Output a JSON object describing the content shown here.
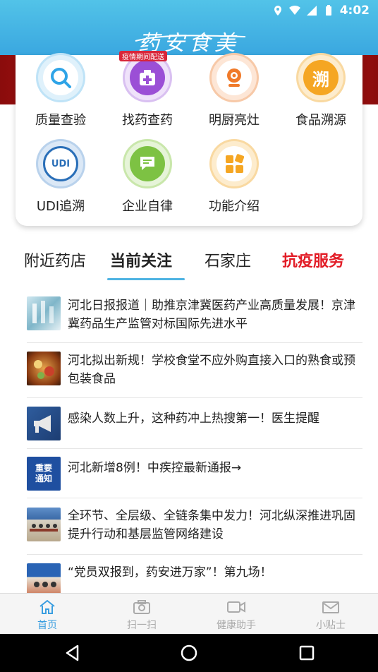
{
  "status_bar": {
    "time": "4:02"
  },
  "header": {
    "logo_text": "药安食美"
  },
  "functions": [
    {
      "label": "质量查验",
      "icon": "search-icon",
      "color": "#2fa4e7"
    },
    {
      "label": "找药查药",
      "icon": "medicine-box-icon",
      "color": "#9b4fd6",
      "badge": "疫情期间配送"
    },
    {
      "label": "明厨亮灶",
      "icon": "camera-icon",
      "color": "#f07a2a"
    },
    {
      "label": "食品溯源",
      "icon": "trace-icon",
      "color": "#f5a623",
      "glyph": "溯"
    },
    {
      "label": "UDI追溯",
      "icon": "udi-icon",
      "color": "#2a6fb8",
      "glyph": "UDI"
    },
    {
      "label": "企业自律",
      "icon": "chat-icon",
      "color": "#7dc243"
    },
    {
      "label": "功能介绍",
      "icon": "grid-icon",
      "color": "#f5a623"
    }
  ],
  "tabs": [
    {
      "label": "附近药店"
    },
    {
      "label": "当前关注"
    },
    {
      "label": "石家庄"
    },
    {
      "label": "抗疫服务"
    }
  ],
  "news": [
    {
      "title": "河北日报报道｜助推京津冀医药产业高质量发展！京津冀药品生产监管对标国际先进水平",
      "thumb": "lab"
    },
    {
      "title": "河北拟出新规！学校食堂不应外购直接入口的熟食或预包装食品",
      "thumb": "food"
    },
    {
      "title": "感染人数上升，这种药冲上热搜第一！医生提醒",
      "thumb": "megaphone"
    },
    {
      "title": "河北新增8例！中疾控最新通报→",
      "thumb": "notice",
      "thumb_text_1": "重要",
      "thumb_text_2": "通知"
    },
    {
      "title": "全环节、全层级、全链条集中发力！河北纵深推进巩固提升行动和基层监管网络建设",
      "thumb": "meeting"
    },
    {
      "title": "“党员双报到，药安进万家”！第九场！",
      "thumb": "event"
    }
  ],
  "bottom_nav": [
    {
      "label": "首页",
      "icon": "home-icon",
      "active": true
    },
    {
      "label": "扫一扫",
      "icon": "camera-scan-icon"
    },
    {
      "label": "健康助手",
      "icon": "video-icon"
    },
    {
      "label": "小贴士",
      "icon": "mail-icon"
    }
  ],
  "colors": {
    "header": "#3aa7e0",
    "accent": "#3a9ee0",
    "alert": "#e21d27"
  }
}
